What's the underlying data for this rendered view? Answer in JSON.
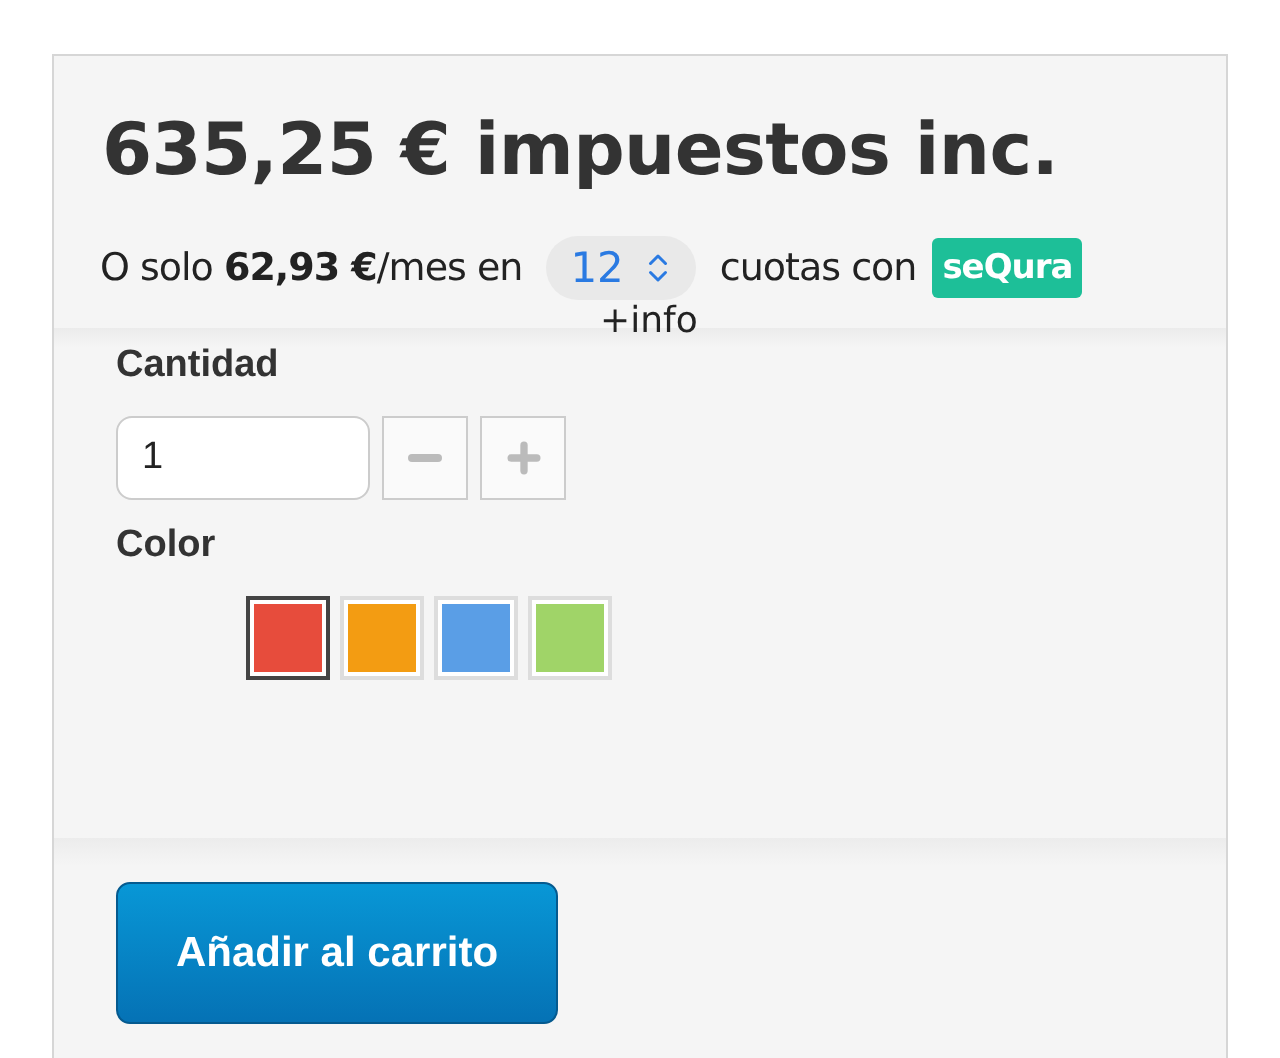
{
  "price": "635,25 € impuestos inc.",
  "financing": {
    "lead": "O solo **62,93 €**/mes en",
    "installments": "12",
    "trail": "cuotas con",
    "provider": "seQura",
    "more_info": "+info"
  },
  "quantity": {
    "label": "Cantidad",
    "value": "1"
  },
  "color": {
    "label": "Color",
    "swatches": [
      {
        "color": "#e74c3c",
        "selected": true
      },
      {
        "color": "#f39c12",
        "selected": false
      },
      {
        "color": "#5a9ee6",
        "selected": false
      },
      {
        "color": "#a0d468",
        "selected": false
      }
    ]
  },
  "add_to_cart": "Añadir al carrito"
}
